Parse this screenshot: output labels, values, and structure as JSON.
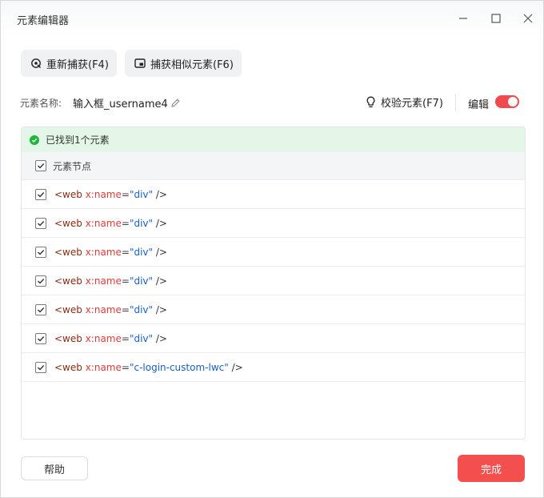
{
  "window": {
    "title": "元素编辑器"
  },
  "toolbar": {
    "recapture_label": "重新捕获(F4)",
    "capture_similar_label": "捕获相似元素(F6)"
  },
  "element": {
    "name_label": "元素名称:",
    "name_value": "输入框_username4",
    "verify_label": "校验元素(F7)",
    "edit_label": "编辑",
    "edit_enabled": true
  },
  "result": {
    "found_text": "已找到1个元素",
    "header_label": "元素节点",
    "rows": [
      {
        "tag": "<web",
        "attr": "x:name",
        "eq": "=",
        "value": "\"div\"",
        "close": "/>",
        "checked": true
      },
      {
        "tag": "<web",
        "attr": "x:name",
        "eq": "=",
        "value": "\"div\"",
        "close": "/>",
        "checked": true
      },
      {
        "tag": "<web",
        "attr": "x:name",
        "eq": "=",
        "value": "\"div\"",
        "close": "/>",
        "checked": true
      },
      {
        "tag": "<web",
        "attr": "x:name",
        "eq": "=",
        "value": "\"div\"",
        "close": "/>",
        "checked": true
      },
      {
        "tag": "<web",
        "attr": "x:name",
        "eq": "=",
        "value": "\"div\"",
        "close": "/>",
        "checked": true
      },
      {
        "tag": "<web",
        "attr": "x:name",
        "eq": "=",
        "value": "\"div\"",
        "close": "/>",
        "checked": true
      },
      {
        "tag": "<web",
        "attr": "x:name",
        "eq": "=",
        "value": "\"c-login-custom-lwc\"",
        "close": "/>",
        "checked": true
      }
    ]
  },
  "footer": {
    "help_label": "帮助",
    "done_label": "完成"
  },
  "colors": {
    "accent": "#f34f4f",
    "toggle_on": "#f2494d",
    "found_bg": "#e4f6e7",
    "found_icon": "#1db53a",
    "tag": "#8b2a14",
    "attr": "#e03a3a",
    "string": "#1560c6"
  }
}
